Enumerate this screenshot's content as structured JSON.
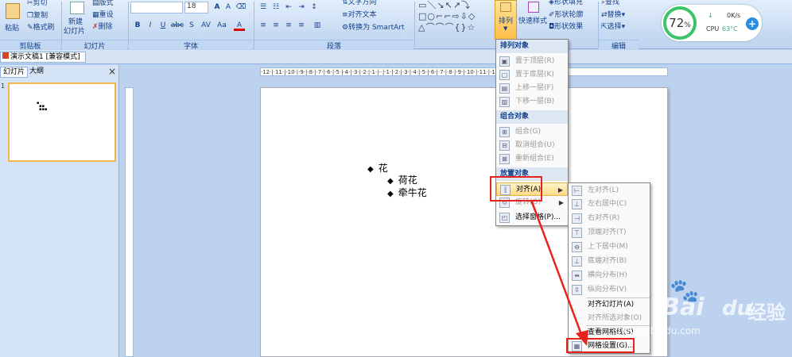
{
  "ribbon": {
    "clipboard": {
      "paste": "粘贴",
      "cut": "剪切",
      "copy": "复制",
      "format_painter": "格式刷",
      "group": "剪贴板"
    },
    "slides": {
      "new_slide": "新建",
      "new_slide2": "幻灯片",
      "layout": "版式",
      "reset": "重设",
      "delete": "删除",
      "group": "幻灯片"
    },
    "font": {
      "size": "18",
      "group": "字体",
      "bold": "B",
      "italic": "I",
      "underline": "U",
      "strike": "abc",
      "shadow": "S",
      "spacing": "AV",
      "case": "Aa",
      "color": "A",
      "grow": "A",
      "shrink": "A"
    },
    "paragraph": {
      "text_direction": "文字方向",
      "align_text": "对齐文本",
      "smartart": "转换为 SmartArt",
      "group": "段落"
    },
    "drawing": {
      "arrange": "排列",
      "quick_styles": "快速样式",
      "shape_fill": "形状填充",
      "shape_outline": "形状轮廓",
      "shape_effects": "形状效果"
    },
    "editing": {
      "find": "查找",
      "replace": "替换",
      "select": "选择",
      "group": "编辑"
    }
  },
  "cpu_widget": {
    "percent": "72",
    "percent_sign": "%",
    "speed": "0K/s",
    "cpu_label": "CPU",
    "temp": "63°C",
    "plus": "+"
  },
  "document": {
    "title": "演示文稿1 [兼容模式]"
  },
  "left_panel": {
    "tab_slides": "幻灯片",
    "tab_outline": "大纲",
    "close": "×",
    "slide_number": "1"
  },
  "ruler": {
    "h_ticks": "·12·|·11·|·10·|·9·|·8·|·7·|·6·|·5·|·4·|·3·|·2·|·1·|··|·1·|·2·|·3·|·4·|·5·|·6·|·7·|·8·|·9·|·10·|·11·|·12·"
  },
  "slide": {
    "bullets": [
      {
        "symbol": "◆",
        "text": "花"
      },
      {
        "symbol": "◆",
        "text": "荷花"
      },
      {
        "symbol": "◆",
        "text": "牵牛花"
      }
    ]
  },
  "arrange_menu": {
    "header_order": "排列对象",
    "bring_front": "置于顶层(R)",
    "send_back": "置于底层(K)",
    "bring_forward": "上移一层(F)",
    "send_backward": "下移一层(B)",
    "header_group": "组合对象",
    "group": "组合(G)",
    "ungroup": "取消组合(U)",
    "regroup": "重新组合(E)",
    "header_position": "放置对象",
    "align": "对齐(A)",
    "rotate": "旋转(O)",
    "selection_pane": "选择窗格(P)..."
  },
  "align_menu": {
    "align_left": "左对齐(L)",
    "align_center": "左右居中(C)",
    "align_right": "右对齐(R)",
    "align_top": "顶端对齐(T)",
    "align_middle": "上下居中(M)",
    "align_bottom": "底端对齐(B)",
    "distribute_h": "横向分布(H)",
    "distribute_v": "纵向分布(V)",
    "align_to_slide": "对齐幻灯片(A)",
    "align_selected": "对齐所选对象(O)",
    "view_gridlines": "查看网格线(S)",
    "grid_settings": "网格设置(G)..."
  },
  "watermark": {
    "brand": "Bai",
    "brand2": "du",
    "sub": "经验",
    "url": "jingyan.baidu.com"
  },
  "colors": {
    "accent_red": "#e8231d",
    "ribbon_text": "#15428b",
    "cpu_green": "#3cc46a"
  }
}
